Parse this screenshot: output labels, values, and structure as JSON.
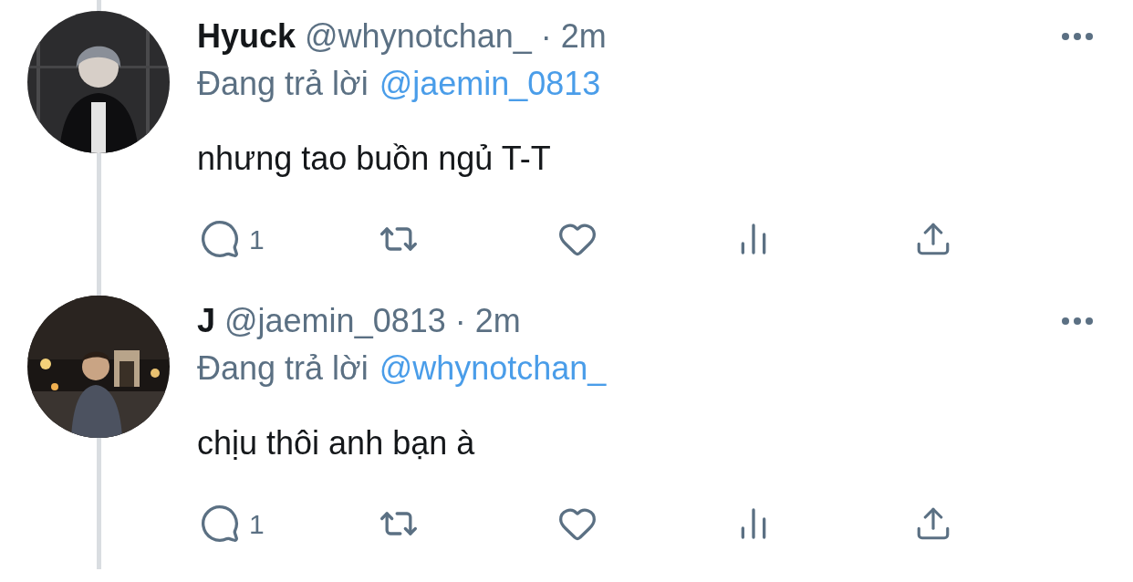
{
  "tweets": [
    {
      "name": "Hyuck",
      "handle": "@whynotchan_",
      "separator": "·",
      "time": "2m",
      "reply_prefix": "Đang trả lời",
      "reply_to": "@jaemin_0813",
      "text": "nhưng tao buồn ngủ T-T",
      "reply_count": "1"
    },
    {
      "name": "J",
      "handle": "@jaemin_0813",
      "separator": "·",
      "time": "2m",
      "reply_prefix": "Đang trả lời",
      "reply_to": "@whynotchan_",
      "text": "chịu thôi anh bạn à",
      "reply_count": "1"
    }
  ]
}
